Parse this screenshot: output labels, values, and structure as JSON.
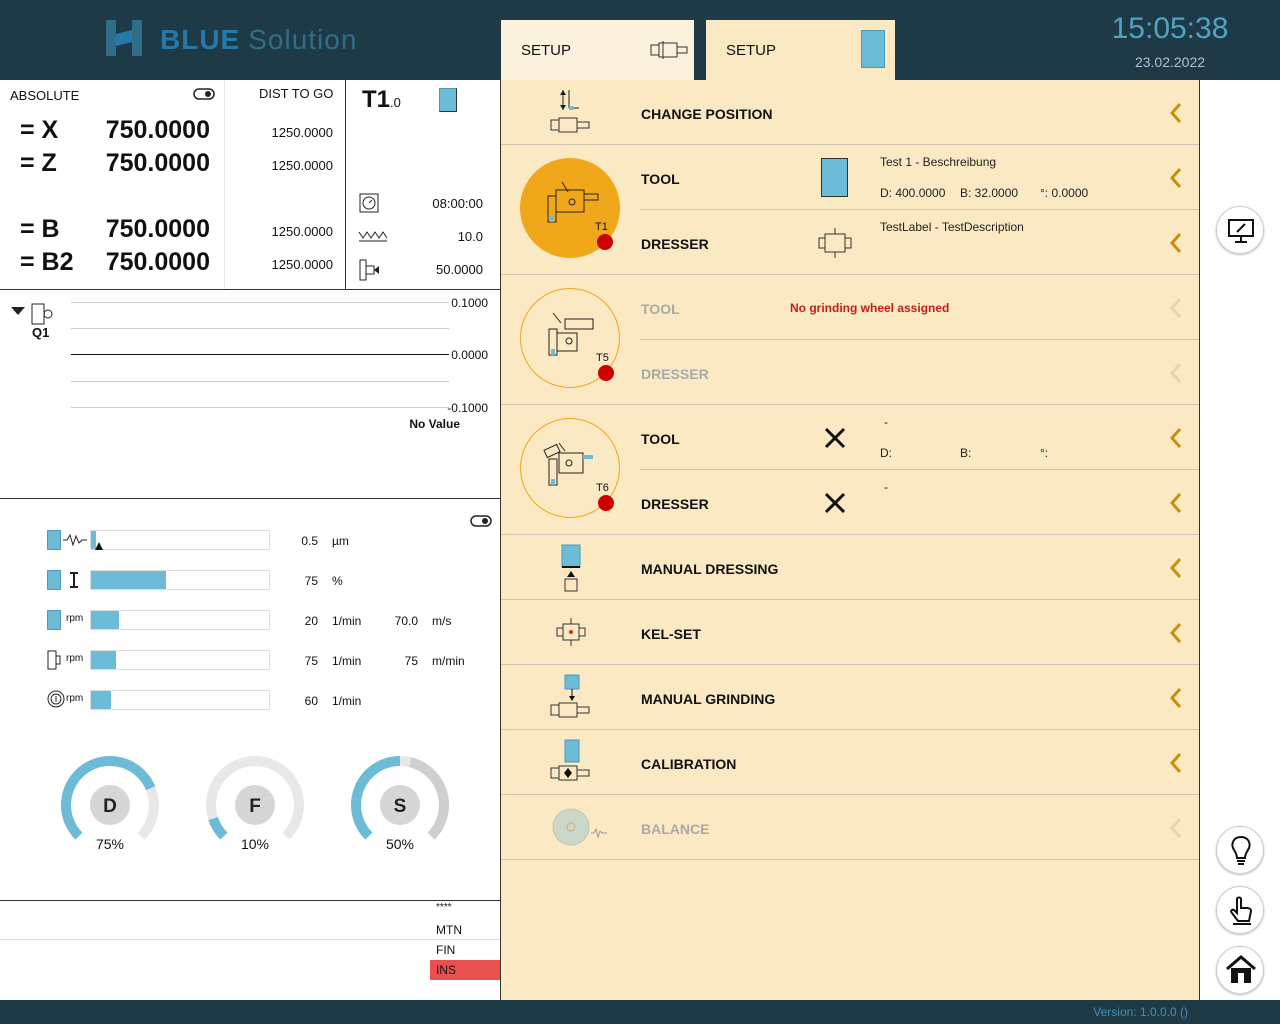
{
  "header": {
    "brand_main": "BLUE",
    "brand_sub": "Solution",
    "tabs": [
      {
        "label": "SETUP"
      },
      {
        "label": "SETUP"
      }
    ],
    "time": "15:05:38",
    "date": "23.02.2022"
  },
  "axes": {
    "absolute_label": "ABSOLUTE",
    "dist_label": "DIST TO GO",
    "rows": [
      {
        "name": "= X",
        "value": "750.0000",
        "dist": "1250.0000"
      },
      {
        "name": "= Z",
        "value": "750.0000",
        "dist": "1250.0000"
      },
      {
        "name": "= B",
        "value": "750.0000",
        "dist": "1250.0000"
      },
      {
        "name": "= B2",
        "value": "750.0000",
        "dist": "1250.0000"
      }
    ]
  },
  "tool_info": {
    "tool": "T1",
    "tool_sub": ".0",
    "time": "08:00:00",
    "feed": "10.0",
    "value": "50.0000"
  },
  "plot": {
    "label": "Q1",
    "y_top": "0.1000",
    "y_mid": "0.0000",
    "y_bottom": "-0.1000",
    "status": "No Value"
  },
  "bars": [
    {
      "value": "0.5",
      "unit": "µm",
      "fill": 0.03
    },
    {
      "value": "75",
      "unit": "%",
      "fill": 0.42
    },
    {
      "prefix": "rpm",
      "value": "20",
      "unit": "1/min",
      "value2": "70.0",
      "unit2": "m/s",
      "fill": 0.16
    },
    {
      "prefix": "rpm",
      "value": "75",
      "unit": "1/min",
      "value2": "75",
      "unit2": "m/min",
      "fill": 0.14
    },
    {
      "prefix": "rpm",
      "value": "60",
      "unit": "1/min",
      "fill": 0.11
    }
  ],
  "gauges": [
    {
      "letter": "D",
      "percent": "75%",
      "level": 0.75
    },
    {
      "letter": "F",
      "percent": "10%",
      "level": 0.1
    },
    {
      "letter": "S",
      "percent": "50%",
      "level": 0.5
    }
  ],
  "status": {
    "stars": "****",
    "mtn": "MTN",
    "fin": "FIN",
    "ins": "INS"
  },
  "menu": {
    "change_position": "CHANGE POSITION",
    "t1": {
      "badge": "T1",
      "tool_label": "TOOL",
      "tool_title": "Test 1 - Beschreibung",
      "tool_d": "D: 400.0000",
      "tool_b": "B: 32.0000",
      "tool_deg": "°: 0.0000",
      "dresser_label": "DRESSER",
      "dresser_title": "TestLabel - TestDescription"
    },
    "t5": {
      "badge": "T5",
      "tool_label": "TOOL",
      "warning": "No grinding wheel assigned",
      "dresser_label": "DRESSER"
    },
    "t6": {
      "badge": "T6",
      "tool_label": "TOOL",
      "dash": "-",
      "d": "D:",
      "b": "B:",
      "deg": "°:",
      "dresser_label": "DRESSER",
      "dresser_dash": "-"
    },
    "manual_dressing": "MANUAL DRESSING",
    "kel_set": "KEL-SET",
    "manual_grinding": "MANUAL GRINDING",
    "calibration": "CALIBRATION",
    "balance": "BALANCE"
  },
  "footer": {
    "version": "Version: 1.0.0.0 ()"
  },
  "colors": {
    "header": "#1e3a47",
    "panel": "#fbe9c3",
    "accent": "#6cbcd8",
    "chevron": "#c8900a",
    "active_tool": "#f0a81a",
    "alert": "#e95151"
  }
}
